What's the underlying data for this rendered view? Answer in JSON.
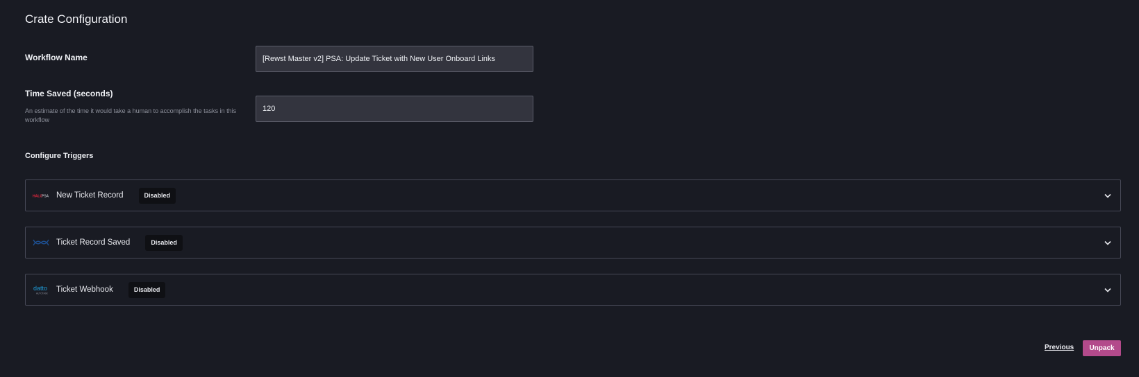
{
  "page": {
    "title": "Crate Configuration"
  },
  "workflow_name": {
    "label": "Workflow Name",
    "value": "[Rewst Master v2] PSA: Update Ticket with New User Onboard Links"
  },
  "time_saved": {
    "label": "Time Saved (seconds)",
    "help": "An estimate of the time it would take a human to accomplish the tasks in this workflow",
    "value": "120"
  },
  "triggers": {
    "title": "Configure Triggers",
    "items": [
      {
        "name": "New Ticket Record",
        "status": "Disabled",
        "logo_icon": "halopsa-logo-icon",
        "logo_text": "HALOPSA"
      },
      {
        "name": "Ticket Record Saved",
        "status": "Disabled",
        "logo_icon": "connectwise-logo-icon",
        "logo_text": ""
      },
      {
        "name": "Ticket Webhook",
        "status": "Disabled",
        "logo_icon": "datto-logo-icon",
        "logo_text": "datto",
        "logo_subtext": "AUTOTASK"
      }
    ]
  },
  "footer": {
    "previous_label": "Previous",
    "unpack_label": "Unpack"
  },
  "colors": {
    "background": "#191b23",
    "input_bg": "#33343e",
    "accent": "#b34a8b",
    "halo_red": "#e0263d",
    "connectwise_blue": "#1d4f91",
    "datto_blue": "#1e9bd7"
  }
}
